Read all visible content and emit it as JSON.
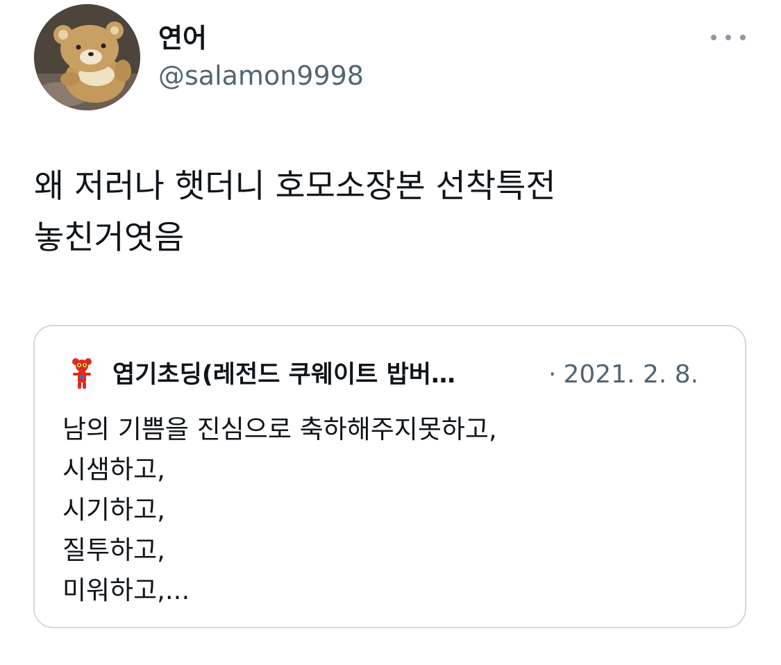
{
  "author": {
    "display_name": "연어",
    "handle": "@salamon9998",
    "avatar": "teddy-bear-plush-photo"
  },
  "more_menu": {
    "icon": "more-horizontal-icon"
  },
  "tweet": {
    "text": "왜 저러나 햇더니 호모소장본 선착특전\n놓친거엿음"
  },
  "quoted_tweet": {
    "display_name": "엽기초딩(레전드 쿠웨이트 밥버…",
    "separator": "·",
    "date": "2021. 2. 8.",
    "avatar": "red-character-avatar",
    "lines": [
      "남의 기쁨을 진심으로 축하해주지못하고,",
      "시샘하고,",
      "시기하고,",
      "질투하고,",
      "미워하고,..."
    ]
  },
  "colors": {
    "text_primary": "#0f1419",
    "text_secondary": "#536471",
    "border": "#cfd9de",
    "icon_gray": "#8b98a5"
  }
}
